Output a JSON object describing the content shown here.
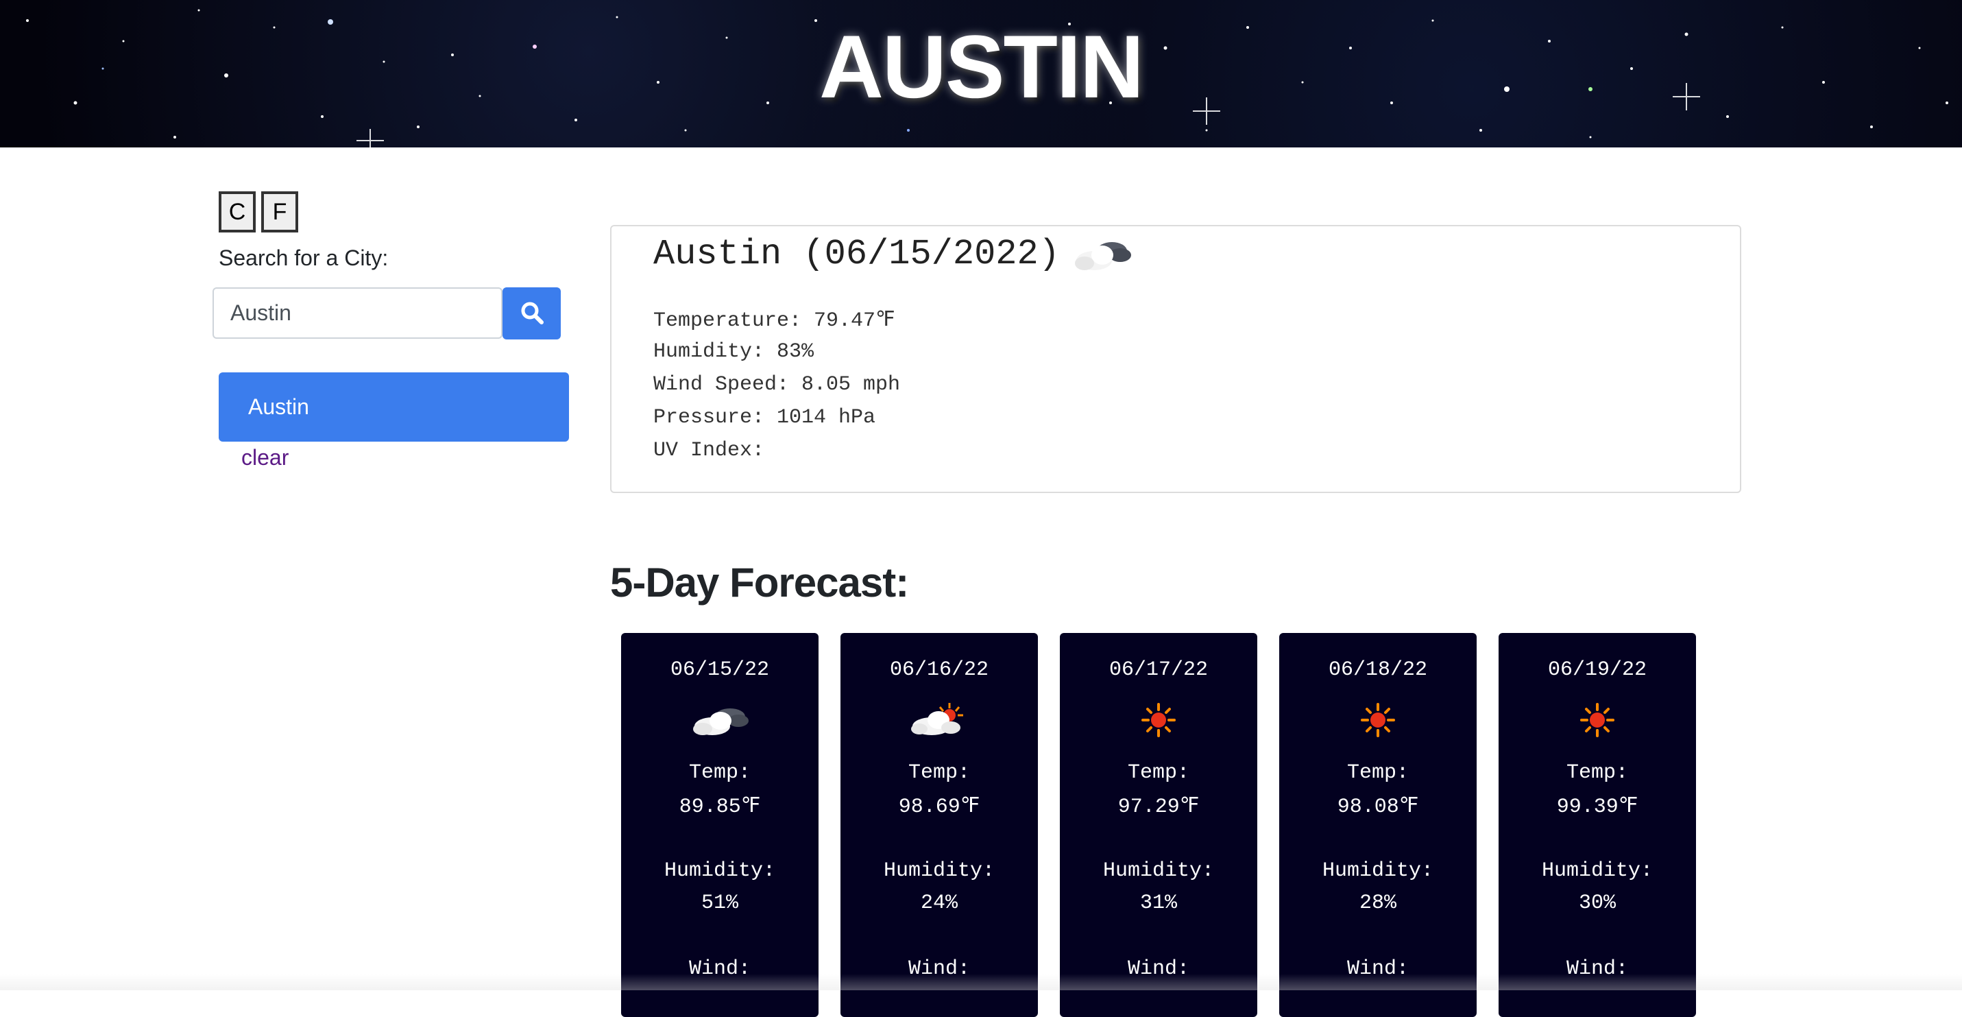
{
  "header": {
    "title": "AUSTIN"
  },
  "units": {
    "celsius_label": "C",
    "fahrenheit_label": "F"
  },
  "search": {
    "label": "Search for a City:",
    "value": "Austin",
    "button_icon": "search-icon"
  },
  "history": {
    "items": [
      "Austin"
    ],
    "clear_label": "clear"
  },
  "current": {
    "title": "Austin (06/15/2022)",
    "icon": "partly-cloudy-icon",
    "temperature": "Temperature: 79.47℉",
    "humidity": "Humidity: 83%",
    "wind": "Wind Speed: 8.05 mph",
    "pressure": "Pressure: 1014 hPa",
    "uv": "UV Index:"
  },
  "forecast": {
    "heading": "5-Day Forecast:",
    "temp_label": "Temp:",
    "humidity_label": "Humidity:",
    "wind_label": "Wind:",
    "days": [
      {
        "date": "06/15/22",
        "icon": "cloud-icon",
        "temp": "89.85℉",
        "humidity": "51%"
      },
      {
        "date": "06/16/22",
        "icon": "sun-behind-cloud-icon",
        "temp": "98.69℉",
        "humidity": "24%"
      },
      {
        "date": "06/17/22",
        "icon": "sun-icon",
        "temp": "97.29℉",
        "humidity": "31%"
      },
      {
        "date": "06/18/22",
        "icon": "sun-icon",
        "temp": "98.08℉",
        "humidity": "28%"
      },
      {
        "date": "06/19/22",
        "icon": "sun-icon",
        "temp": "99.39℉",
        "humidity": "30%"
      }
    ]
  },
  "colors": {
    "accent": "#3b7ded",
    "card_bg": "#030120",
    "link": "#5b1a86"
  }
}
